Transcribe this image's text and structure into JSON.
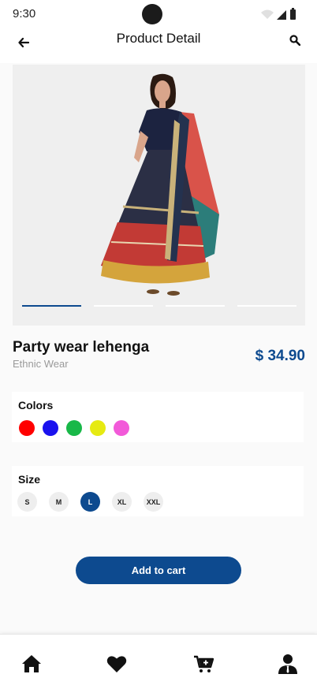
{
  "status_bar": {
    "time": "9:30"
  },
  "app_bar": {
    "title": "Product Detail"
  },
  "gallery": {
    "image_count": 4,
    "active_index": 0
  },
  "product": {
    "name": "Party wear lehenga",
    "category": "Ethnic Wear",
    "price": "$ 34.90"
  },
  "colors": {
    "title": "Colors",
    "options": [
      "#ff0000",
      "#1a12ee",
      "#18b848",
      "#e6ea12",
      "#f25ad9"
    ]
  },
  "sizes": {
    "title": "Size",
    "options": [
      "S",
      "M",
      "L",
      "XL",
      "XXL"
    ],
    "selected": "L"
  },
  "cart_button": {
    "label": "Add to cart"
  },
  "bottom_nav": [
    "home-icon",
    "heart-icon",
    "cart-add-icon",
    "user-icon"
  ],
  "theme": {
    "accent": "#0d4a8f"
  }
}
